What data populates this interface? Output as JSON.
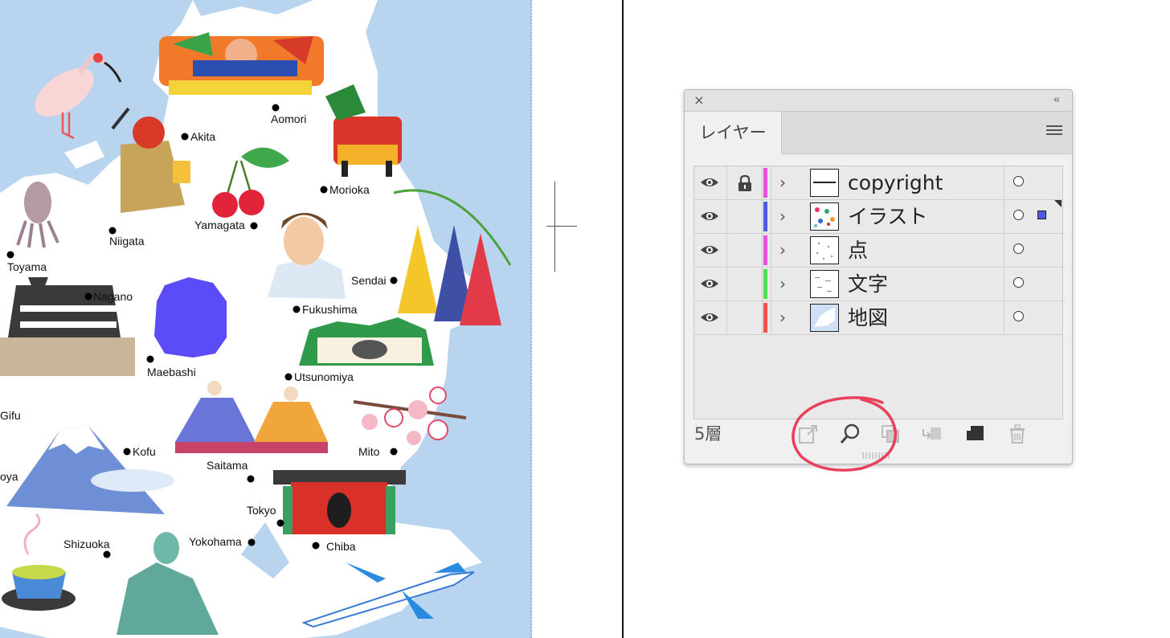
{
  "map": {
    "cities": [
      "Aomori",
      "Akita",
      "Morioka",
      "Yamagata",
      "Niigata",
      "Toyama",
      "Sendai",
      "Nagano",
      "Fukushima",
      "Maebashi",
      "Utsunomiya",
      "Gifu",
      "Kofu",
      "Mito",
      "Saitama",
      "oya",
      "Tokyo",
      "Shizuoka",
      "Yokohama",
      "Chiba"
    ],
    "colors": {
      "sea": "#b9d4ee",
      "land": "#ffffff",
      "dots": "#000000"
    }
  },
  "panel": {
    "tab_label": "レイヤー",
    "close_icon": "×",
    "collapse_icon": "‹‹",
    "layer_count": "5層",
    "layers": [
      {
        "name": "copyright",
        "color": "#ec4fe3",
        "locked": true,
        "selected": false
      },
      {
        "name": "イラスト",
        "color": "#4d5be3",
        "locked": false,
        "selected": true
      },
      {
        "name": "点",
        "color": "#ec4fe3",
        "locked": false,
        "selected": false
      },
      {
        "name": "文字",
        "color": "#4ee052",
        "locked": false,
        "selected": false
      },
      {
        "name": "地図",
        "color": "#f2504a",
        "locked": false,
        "selected": false
      }
    ],
    "highlight_color": "#e8415b"
  }
}
